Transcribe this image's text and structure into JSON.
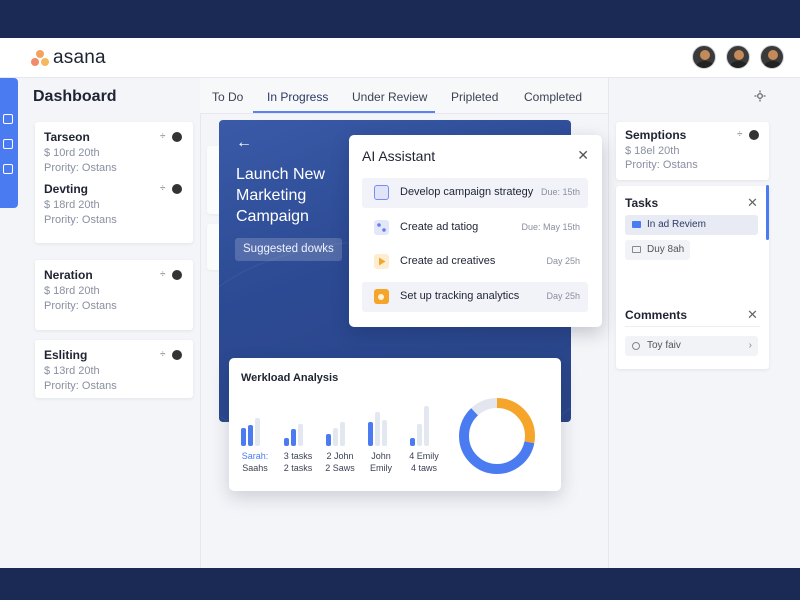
{
  "app": {
    "brand": "asana"
  },
  "dashboard": {
    "title": "Dashboard"
  },
  "tabs": [
    "To Do",
    "In Progress",
    "Under Review",
    "Pripleted",
    "Completed"
  ],
  "left_tasks": [
    {
      "title": "Tarseon",
      "line1": "$ 10rd 20th",
      "line2": "Prority: Ostans",
      "meta": "÷"
    },
    {
      "title": "Devting",
      "line1": "$ 18rd 20th",
      "line2": "Prority: Ostans",
      "meta": "÷"
    },
    {
      "title": "Neration",
      "line1": "$ 18rd 20th",
      "line2": "Prority: Ostans",
      "meta": "÷"
    },
    {
      "title": "Esliting",
      "line1": "$ 13rd 20th",
      "line2": "Prority: Ostans",
      "meta": "÷"
    }
  ],
  "hero": {
    "title": "Launch New Marketing Campaign",
    "chip": "Suggested dowks"
  },
  "ai_assistant": {
    "title": "AI Assistant",
    "items": [
      {
        "label": "Develop campaign strategy",
        "due": "Due: 15th",
        "color": "#7b8cf0"
      },
      {
        "label": "Create ad tatiog",
        "due": "Due: May 15th",
        "color": "#6a7de6"
      },
      {
        "label": "Create ad creatives",
        "due": "Day 25h",
        "color": "#f5a52a"
      },
      {
        "label": "Set up tracking analytics",
        "due": "Day 25h",
        "color": "#f5a52a"
      }
    ]
  },
  "workload": {
    "title": "Werkload Analysis",
    "people": [
      {
        "line1": "Sarah:",
        "line2": "Saahs"
      },
      {
        "line1": "3 tasks",
        "line2": "2 tasks"
      },
      {
        "line1": "2 John",
        "line2": "2 Saws"
      },
      {
        "line1": "John",
        "line2": "Emily"
      },
      {
        "line1": "4 Emily",
        "line2": "4 taws"
      }
    ],
    "donut": {
      "orange": 0.28,
      "blue": 0.6,
      "grey": 0.12
    }
  },
  "right": {
    "card1": {
      "title": "Semptions",
      "line1": "$ 18el 20th",
      "line2": "Prority: Ostans",
      "meta": "÷"
    },
    "tasks": {
      "title": "Tasks",
      "pill1": "In ad Reviem",
      "pill2": "Duy 8ah"
    },
    "comments": {
      "title": "Comments",
      "item": "Toy faiv"
    }
  },
  "colors": {
    "accent": "#4a7bf0",
    "orange": "#f5a52a",
    "hero": "#2c4a93"
  }
}
